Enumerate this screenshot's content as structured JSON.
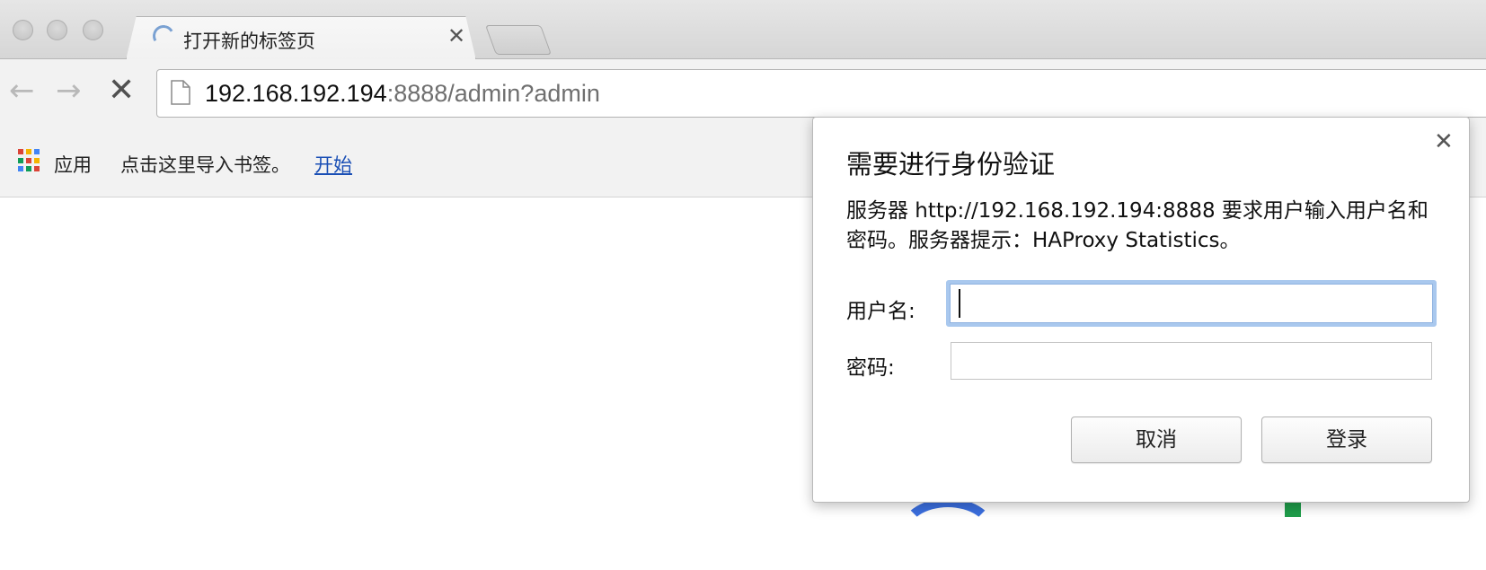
{
  "tab": {
    "title": "打开新的标签页",
    "close_glyph": "✕",
    "loading_icon": "spinner-icon"
  },
  "toolbar": {
    "back_glyph": "←",
    "forward_glyph": "→",
    "stop_glyph": "✕",
    "url_host": "192.168.192.194",
    "url_rest": ":8888/admin?admin"
  },
  "bookmarks": {
    "apps_label": "应用",
    "import_hint": "点击这里导入书签。",
    "start_link": "开始",
    "apps_colors": [
      "#db4437",
      "#f4b400",
      "#4285f4",
      "#0f9d58",
      "#db4437",
      "#f4b400",
      "#4285f4",
      "#0f9d58",
      "#db4437"
    ]
  },
  "dialog": {
    "title": "需要进行身份验证",
    "message": "服务器 http://192.168.192.194:8888 要求用户输入用户名和密码。服务器提示：HAProxy Statistics。",
    "username_label": "用户名:",
    "username_value": "",
    "password_label": "密码:",
    "password_value": "",
    "cancel_label": "取消",
    "login_label": "登录",
    "close_glyph": "✕"
  }
}
